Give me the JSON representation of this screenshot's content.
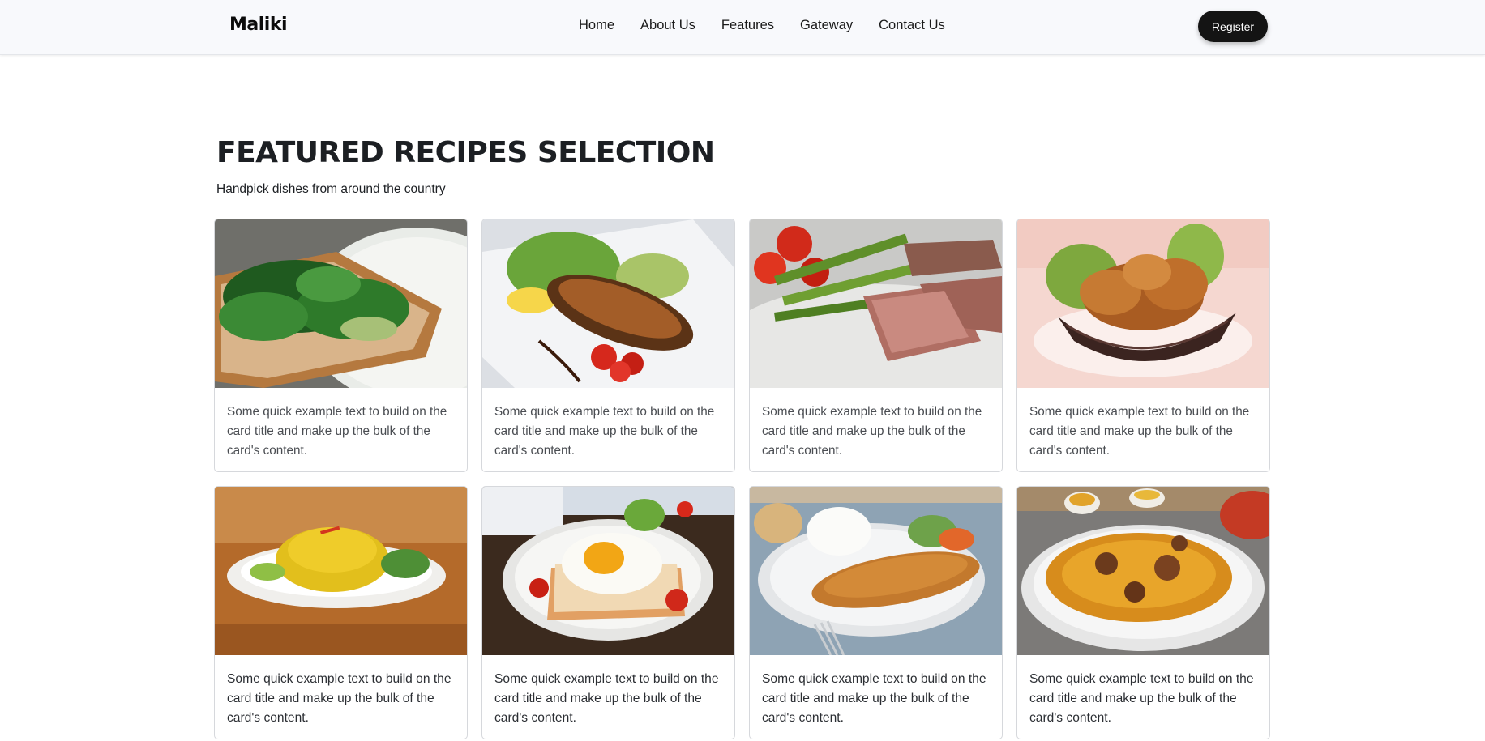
{
  "nav": {
    "brand": "Maliki",
    "links": [
      "Home",
      "About Us",
      "Features",
      "Gateway",
      "Contact Us"
    ],
    "register_label": "Register"
  },
  "hero": {
    "title": "FEATURED RECIPES SELECTION",
    "subtitle": "Handpick dishes from around the country"
  },
  "cards": [
    {
      "text": "Some quick example text to build on the card title and make up the bulk of the card's content."
    },
    {
      "text": "Some quick example text to build on the card title and make up the bulk of the card's content."
    },
    {
      "text": "Some quick example text to build on the card title and make up the bulk of the card's content."
    },
    {
      "text": "Some quick example text to build on the card title and make up the bulk of the card's content."
    },
    {
      "text": "Some quick example text to build on the card title and make up the bulk of the card's content."
    },
    {
      "text": "Some quick example text to build on the card title and make up the bulk of the card's content."
    },
    {
      "text": "Some quick example text to build on the card title and make up the bulk of the card's content."
    },
    {
      "text": "Some quick example text to build on the card title and make up the bulk of the card's content."
    }
  ]
}
